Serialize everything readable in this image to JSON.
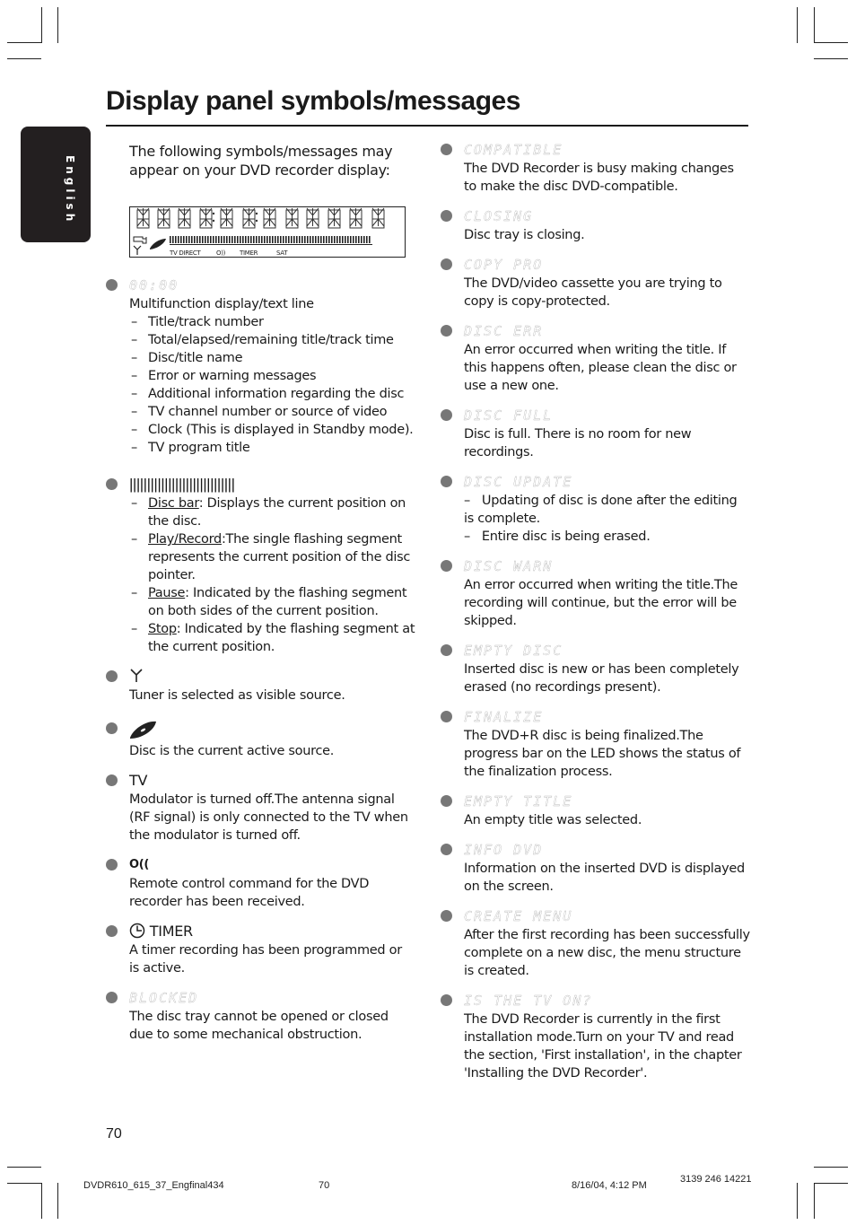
{
  "page": {
    "title": "Display panel symbols/messages",
    "language_tab": "English",
    "page_number": "70"
  },
  "intro": "The following symbols/messages may appear on your DVD recorder display:",
  "lcd_panel": {
    "labels": [
      "TV DIRECT",
      "O))",
      "TIMER",
      "SAT"
    ]
  },
  "left_entries": [
    {
      "symbol": "00:00",
      "symbol_type": "lcd",
      "desc": "Multifunction display/text line",
      "list": [
        "Title/track number",
        "Total/elapsed/remaining title/track time",
        "Disc/title name",
        "Error or warning messages",
        "Additional information regarding the disc",
        "TV channel number or source of video",
        "Clock (This is displayed in Standby mode).",
        "TV program title"
      ]
    },
    {
      "symbol": "||||||||||||||||||||||||||||||",
      "symbol_type": "bars",
      "list_rich": [
        {
          "term": "Disc bar",
          "text": ": Displays the current position on the disc."
        },
        {
          "term": "Play/Record",
          "text": ":The single flashing segment represents the current position of the disc pointer."
        },
        {
          "term": "Pause",
          "text": ": Indicated by the flashing segment on both sides of the current position."
        },
        {
          "term": "Stop",
          "text": ": Indicated by the flashing segment at the current position."
        }
      ]
    },
    {
      "symbol": "Y",
      "symbol_type": "antenna-icon",
      "desc": "Tuner is selected as visible source."
    },
    {
      "symbol": "disc",
      "symbol_type": "disc-icon",
      "desc": "Disc is the current active source."
    },
    {
      "symbol": "TV",
      "symbol_type": "text",
      "desc": "Modulator is turned off.The antenna signal (RF signal) is only connected to the TV when the modulator is turned off."
    },
    {
      "symbol": "O((",
      "symbol_type": "remote-icon",
      "desc": "Remote control command for the DVD recorder has been received."
    },
    {
      "symbol": "TIMER",
      "symbol_type": "timer",
      "desc": "A timer recording has been programmed or is active."
    },
    {
      "symbol": "BLOCKED",
      "symbol_type": "lcd",
      "desc": "The disc tray cannot be opened or closed due to some mechanical obstruction."
    }
  ],
  "right_entries": [
    {
      "symbol": "COMPATIBLE",
      "desc": "The DVD Recorder is busy making changes to make the disc DVD-compatible."
    },
    {
      "symbol": "CLOSING",
      "desc": "Disc tray is closing."
    },
    {
      "symbol": "COPY PRO",
      "desc": "The DVD/video cassette you are trying to copy is copy-protected."
    },
    {
      "symbol": "DISC ERR",
      "desc": "An error occurred when writing the title. If this happens often, please clean the disc or use a new one."
    },
    {
      "symbol": "DISC FULL",
      "desc": "Disc is full.  There is no room for new recordings."
    },
    {
      "symbol": "DISC UPDATE",
      "list": [
        "Updating of disc is done after the editing is complete.",
        "Entire disc is being erased."
      ]
    },
    {
      "symbol": "DISC WARN",
      "desc": "An error occurred when writing the title.The recording will continue, but the error will be skipped."
    },
    {
      "symbol": "EMPTY DISC",
      "desc": "Inserted disc is new or has been completely erased (no recordings present)."
    },
    {
      "symbol": "FINALIZE",
      "desc": "The DVD+R disc is being finalized.The progress bar on the LED shows the status of the finalization process."
    },
    {
      "symbol": "EMPTY TITLE",
      "desc": "An empty title was selected."
    },
    {
      "symbol": "INFO DVD",
      "desc": "Information on the inserted DVD is displayed on the screen."
    },
    {
      "symbol": "CREATE MENU",
      "desc": "After the first recording has been successfully complete on a new disc, the menu structure is created."
    },
    {
      "symbol": "IS THE TV ON?",
      "desc": "The DVD Recorder is currently in the first installation mode.Turn on your TV and read the section, 'First installation', in the chapter 'Installing the DVD Recorder'."
    }
  ],
  "footer": {
    "file": "DVDR610_615_37_Engfinal434",
    "page": "70",
    "date": "8/16/04, 4:12 PM",
    "code": "3139 246 14221"
  }
}
